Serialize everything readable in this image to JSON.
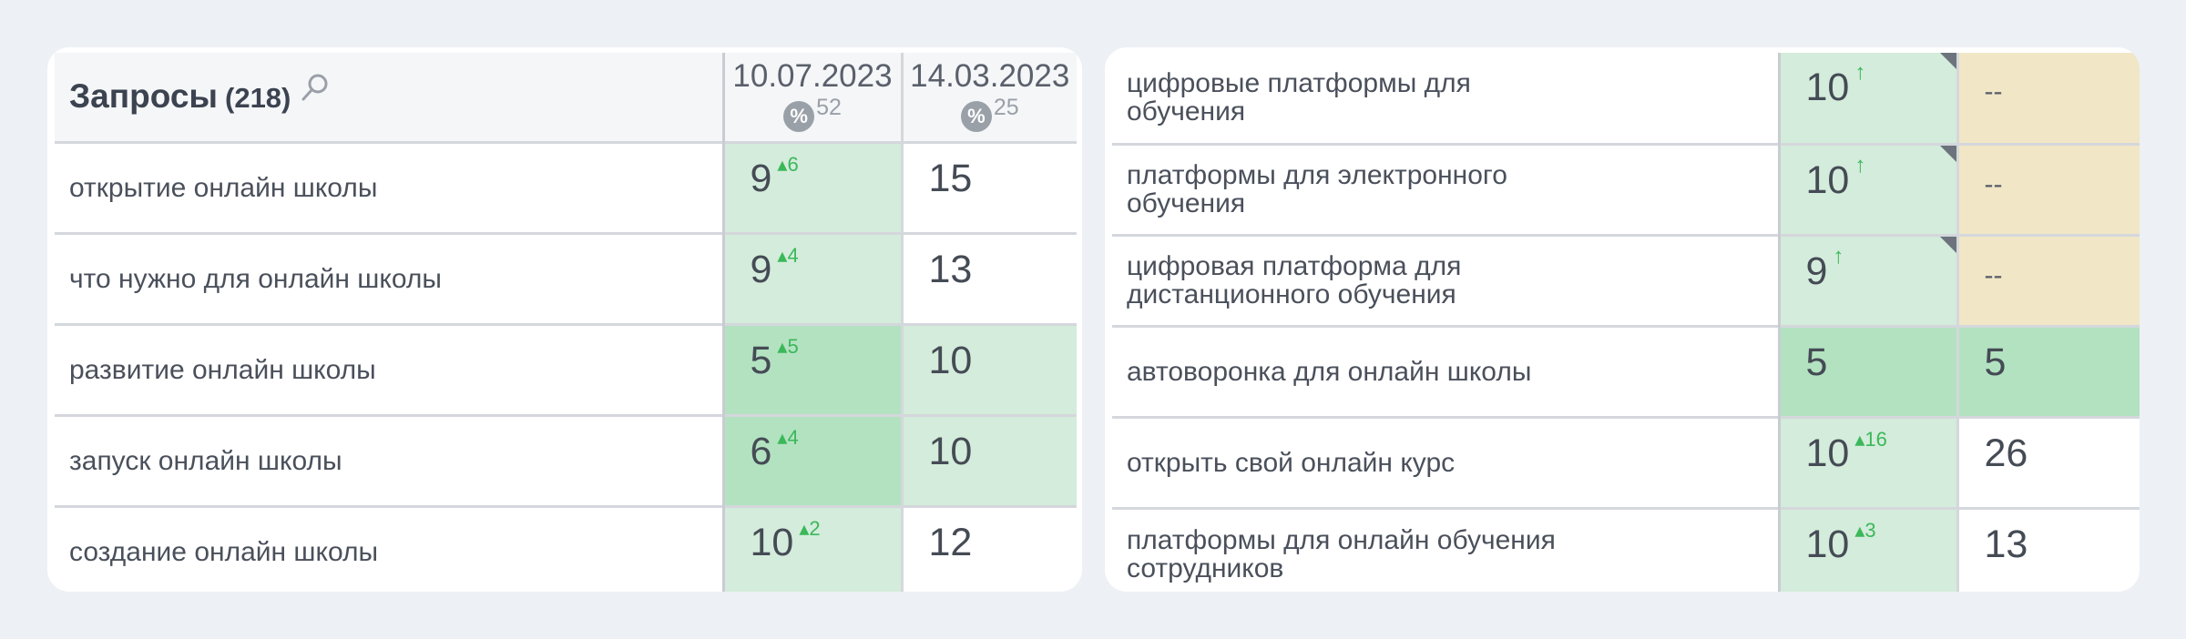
{
  "left": {
    "title": "Запросы",
    "count": "(218)",
    "dates": [
      {
        "label": "10.07.2023",
        "badge": "%",
        "pct": "52"
      },
      {
        "label": "14.03.2023",
        "badge": "%",
        "pct": "25"
      }
    ],
    "rows": [
      {
        "keyword": "открытие онлайн школы",
        "pos1": "9",
        "delta1": "▴6",
        "pos2": "15"
      },
      {
        "keyword": "что нужно для онлайн школы",
        "pos1": "9",
        "delta1": "▴4",
        "pos2": "13"
      },
      {
        "keyword": "развитие онлайн школы",
        "pos1": "5",
        "delta1": "▴5",
        "pos2": "10"
      },
      {
        "keyword": "запуск онлайн школы",
        "pos1": "6",
        "delta1": "▴4",
        "pos2": "10"
      },
      {
        "keyword": "создание онлайн школы",
        "pos1": "10",
        "delta1": "▴2",
        "pos2": "12"
      }
    ]
  },
  "right": {
    "rows": [
      {
        "line1": "цифровые платформы для",
        "line2": "обучения",
        "pos1": "10",
        "arrow1": "↑",
        "pos2": "--"
      },
      {
        "line1": "платформы для электронного",
        "line2": "обучения",
        "pos1": "10",
        "arrow1": "↑",
        "pos2": "--"
      },
      {
        "line1": "цифровая платформа для",
        "line2": "дистанционного обучения",
        "pos1": "9",
        "arrow1": "↑",
        "pos2": "--"
      },
      {
        "line1": "автоворонка для онлайн школы",
        "line2": "",
        "pos1": "5",
        "pos2": "5"
      },
      {
        "line1": "открыть свой онлайн курс",
        "line2": "",
        "pos1": "10",
        "delta1": "▴16",
        "pos2": "26"
      },
      {
        "line1": "платформы для онлайн обучения",
        "line2": "сотрудников",
        "pos1": "10",
        "delta1": "▴3",
        "pos2": "13"
      }
    ]
  }
}
